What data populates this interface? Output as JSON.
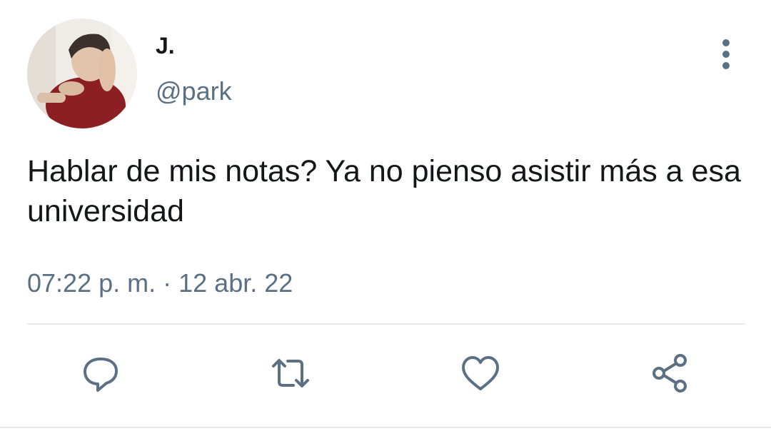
{
  "tweet": {
    "display_name": "J.",
    "handle": "@park",
    "text": "Hablar de mis notas? Ya no pienso asistir más a esa universidad",
    "time": "07:22 p. m.",
    "separator": "·",
    "date": "12 abr. 22"
  },
  "icons": {
    "more": "more-vertical-icon",
    "reply": "reply-icon",
    "retweet": "retweet-icon",
    "like": "heart-icon",
    "share": "share-icon"
  },
  "colors": {
    "text": "#14171a",
    "secondary": "#5b7083",
    "divider": "#e6ecf0"
  }
}
